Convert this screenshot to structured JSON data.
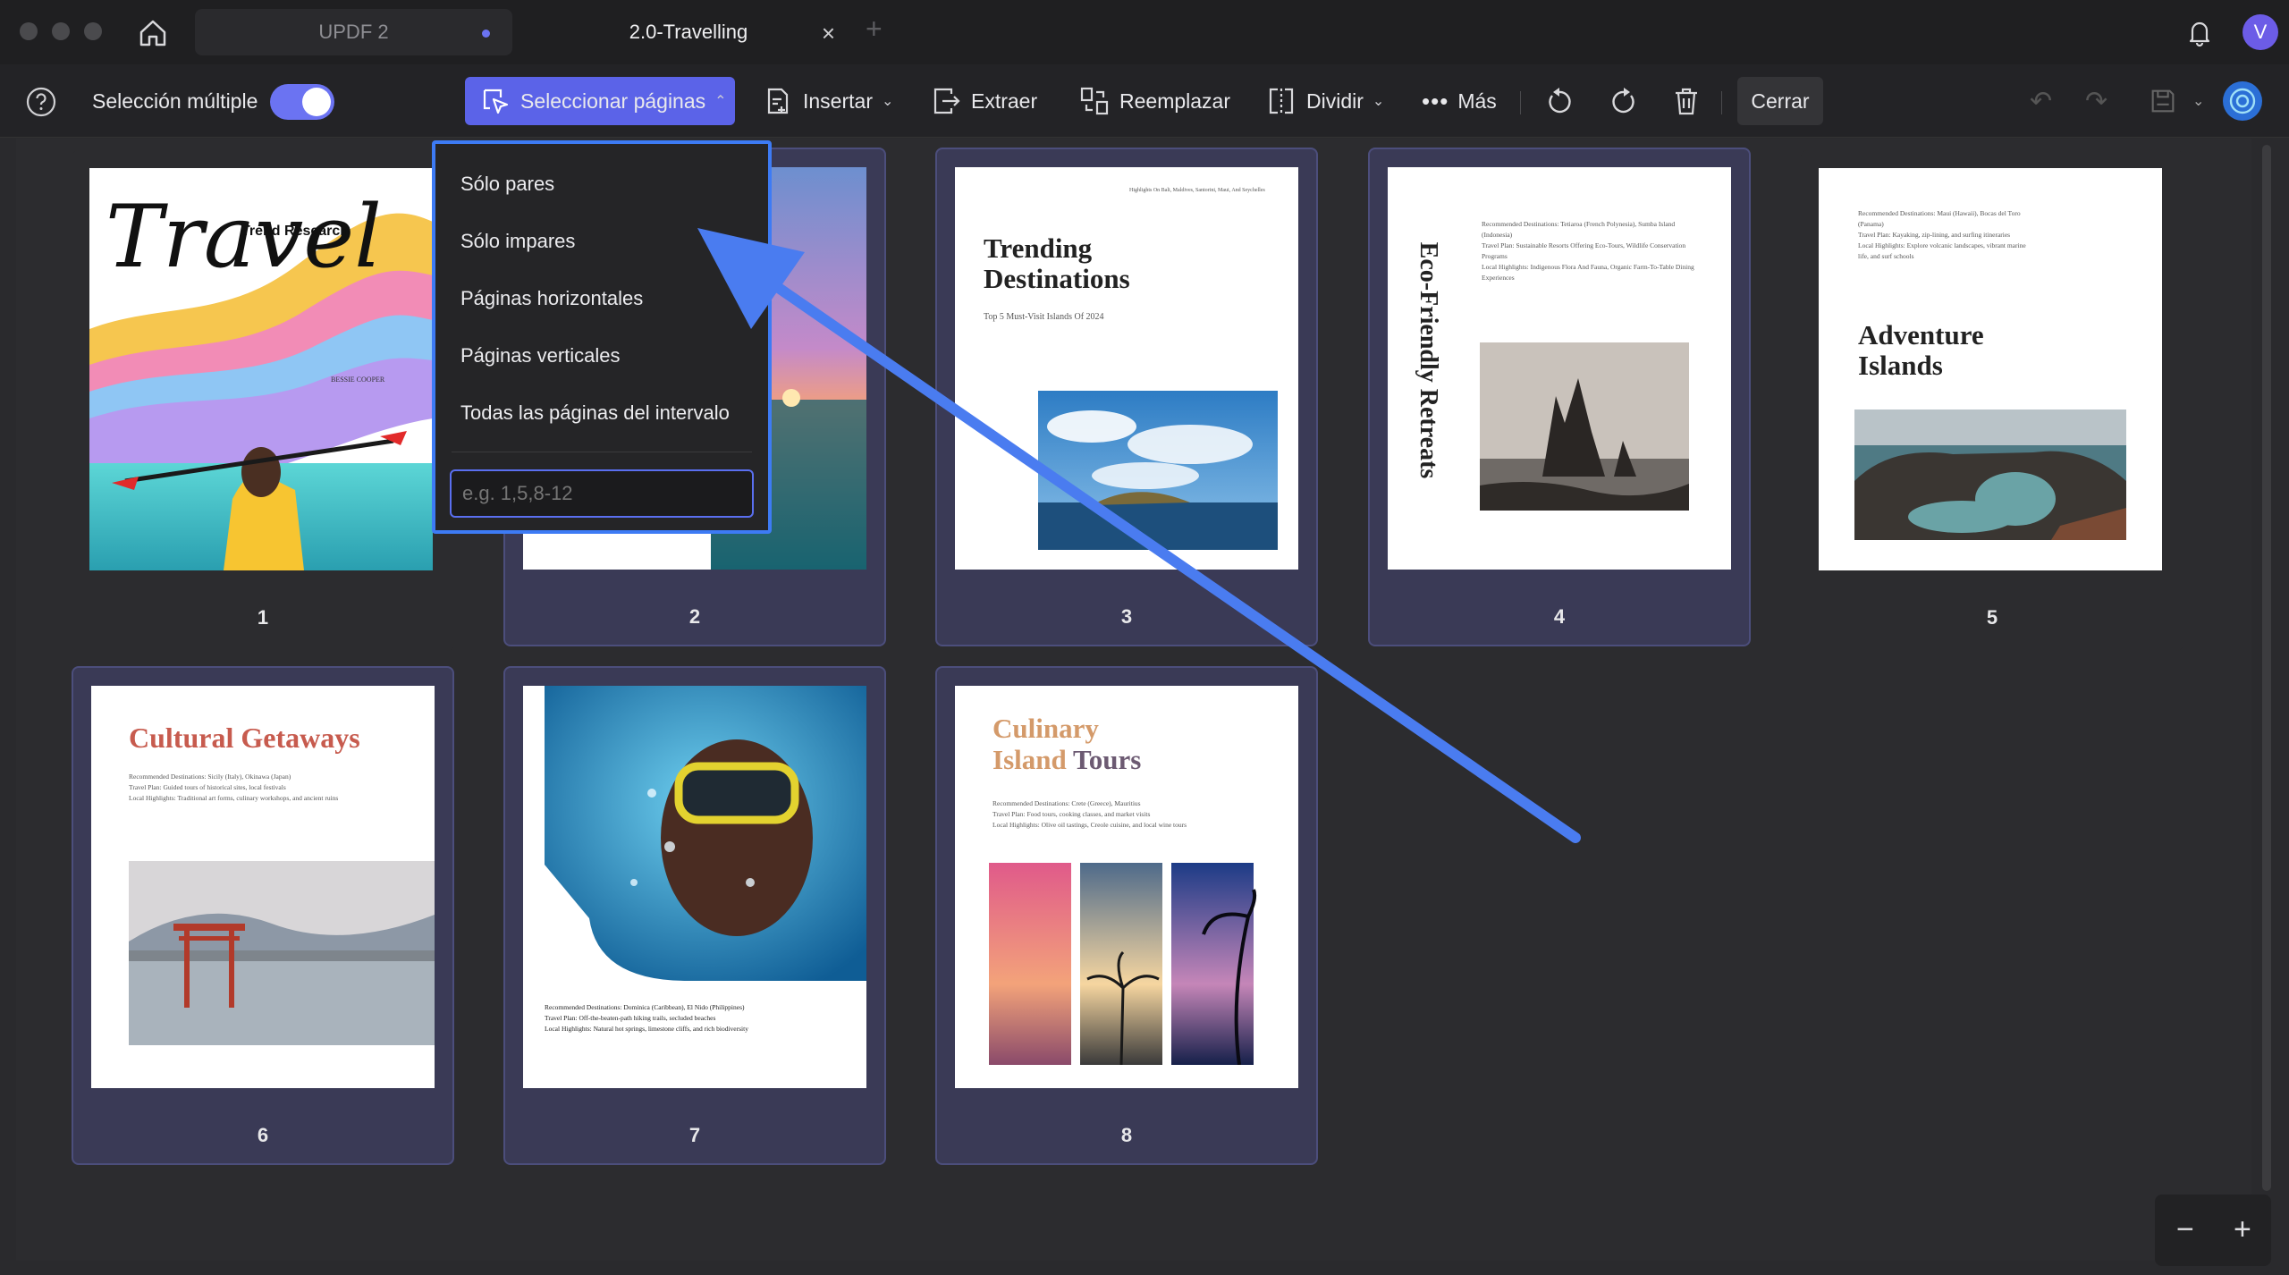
{
  "window": {
    "tabs": [
      {
        "label": "UPDF 2"
      },
      {
        "label": "2.0-Travelling"
      }
    ],
    "avatar_letter": "V"
  },
  "toolbar": {
    "multi_select_label": "Selección múltiple",
    "multi_select_on": true,
    "select_pages_label": "Seleccionar páginas",
    "insert_label": "Insertar",
    "extract_label": "Extraer",
    "replace_label": "Reemplazar",
    "split_label": "Dividir",
    "more_label": "Más",
    "close_label": "Cerrar"
  },
  "dropdown": {
    "items": [
      "Sólo pares",
      "Sólo impares",
      "Páginas horizontales",
      "Páginas verticales",
      "Todas las páginas del intervalo"
    ],
    "input_placeholder": "e.g. 1,5,8-12"
  },
  "pages": [
    {
      "number": "1",
      "title": "Travel",
      "subtitle": "Trend Research",
      "author": "BESSIE COOPER",
      "selected": false
    },
    {
      "number": "2",
      "selected": true
    },
    {
      "number": "3",
      "title": "Trending Destinations",
      "subtitle": "Top 5 Must-Visit Islands Of 2024",
      "selected": true
    },
    {
      "number": "4",
      "title": "Eco-Friendly Retreats",
      "selected": true
    },
    {
      "number": "5",
      "title": "Adventure Islands",
      "selected": false
    },
    {
      "number": "6",
      "title": "Cultural Getaways",
      "selected": true
    },
    {
      "number": "7",
      "selected": true
    },
    {
      "number": "8",
      "title_line1": "Culinary",
      "title_line2": "Island Tours",
      "selected": true
    }
  ],
  "page_text": {
    "p3_top": "Highlights On Bali, Maldives, Santorini, Maui, And Seychelles",
    "p4_body": "Recommended Destinations: Tetiaroa (French Polynesia), Sumba Island (Indonesia)\nTravel Plan: Sustainable Resorts Offering Eco-Tours, Wildlife Conservation Programs\nLocal Highlights: Indigenous Flora And Fauna, Organic Farm-To-Table Dining Experiences",
    "p5_body": "Recommended Destinations: Maui (Hawaii), Bocas del Toro (Panama)\nTravel Plan: Kayaking, zip-lining, and surfing itineraries\nLocal Highlights: Explore volcanic landscapes, vibrant marine life, and surf schools",
    "p6_body": "Recommended Destinations: Sicily (Italy), Okinawa (Japan)\nTravel Plan: Guided tours of historical sites, local festivals\nLocal Highlights: Traditional art forms, culinary workshops, and ancient ruins",
    "p7_body": "Recommended Destinations: Dominica (Caribbean), El Nido (Philippines)\nTravel Plan: Off-the-beaten-path hiking trails, secluded beaches\nLocal Highlights: Natural hot springs, limestone cliffs, and rich biodiversity",
    "p8_body": "Recommended Destinations: Crete (Greece), Mauritius\nTravel Plan: Food tours, cooking classes, and market visits\nLocal Highlights: Olive oil tastings, Creole cuisine, and local wine tours"
  },
  "colors": {
    "accent": "#5b63e8",
    "dropdown_border": "#3d7bf5",
    "arrow": "#4a7cf0",
    "selected_card": "#3a3a56"
  }
}
